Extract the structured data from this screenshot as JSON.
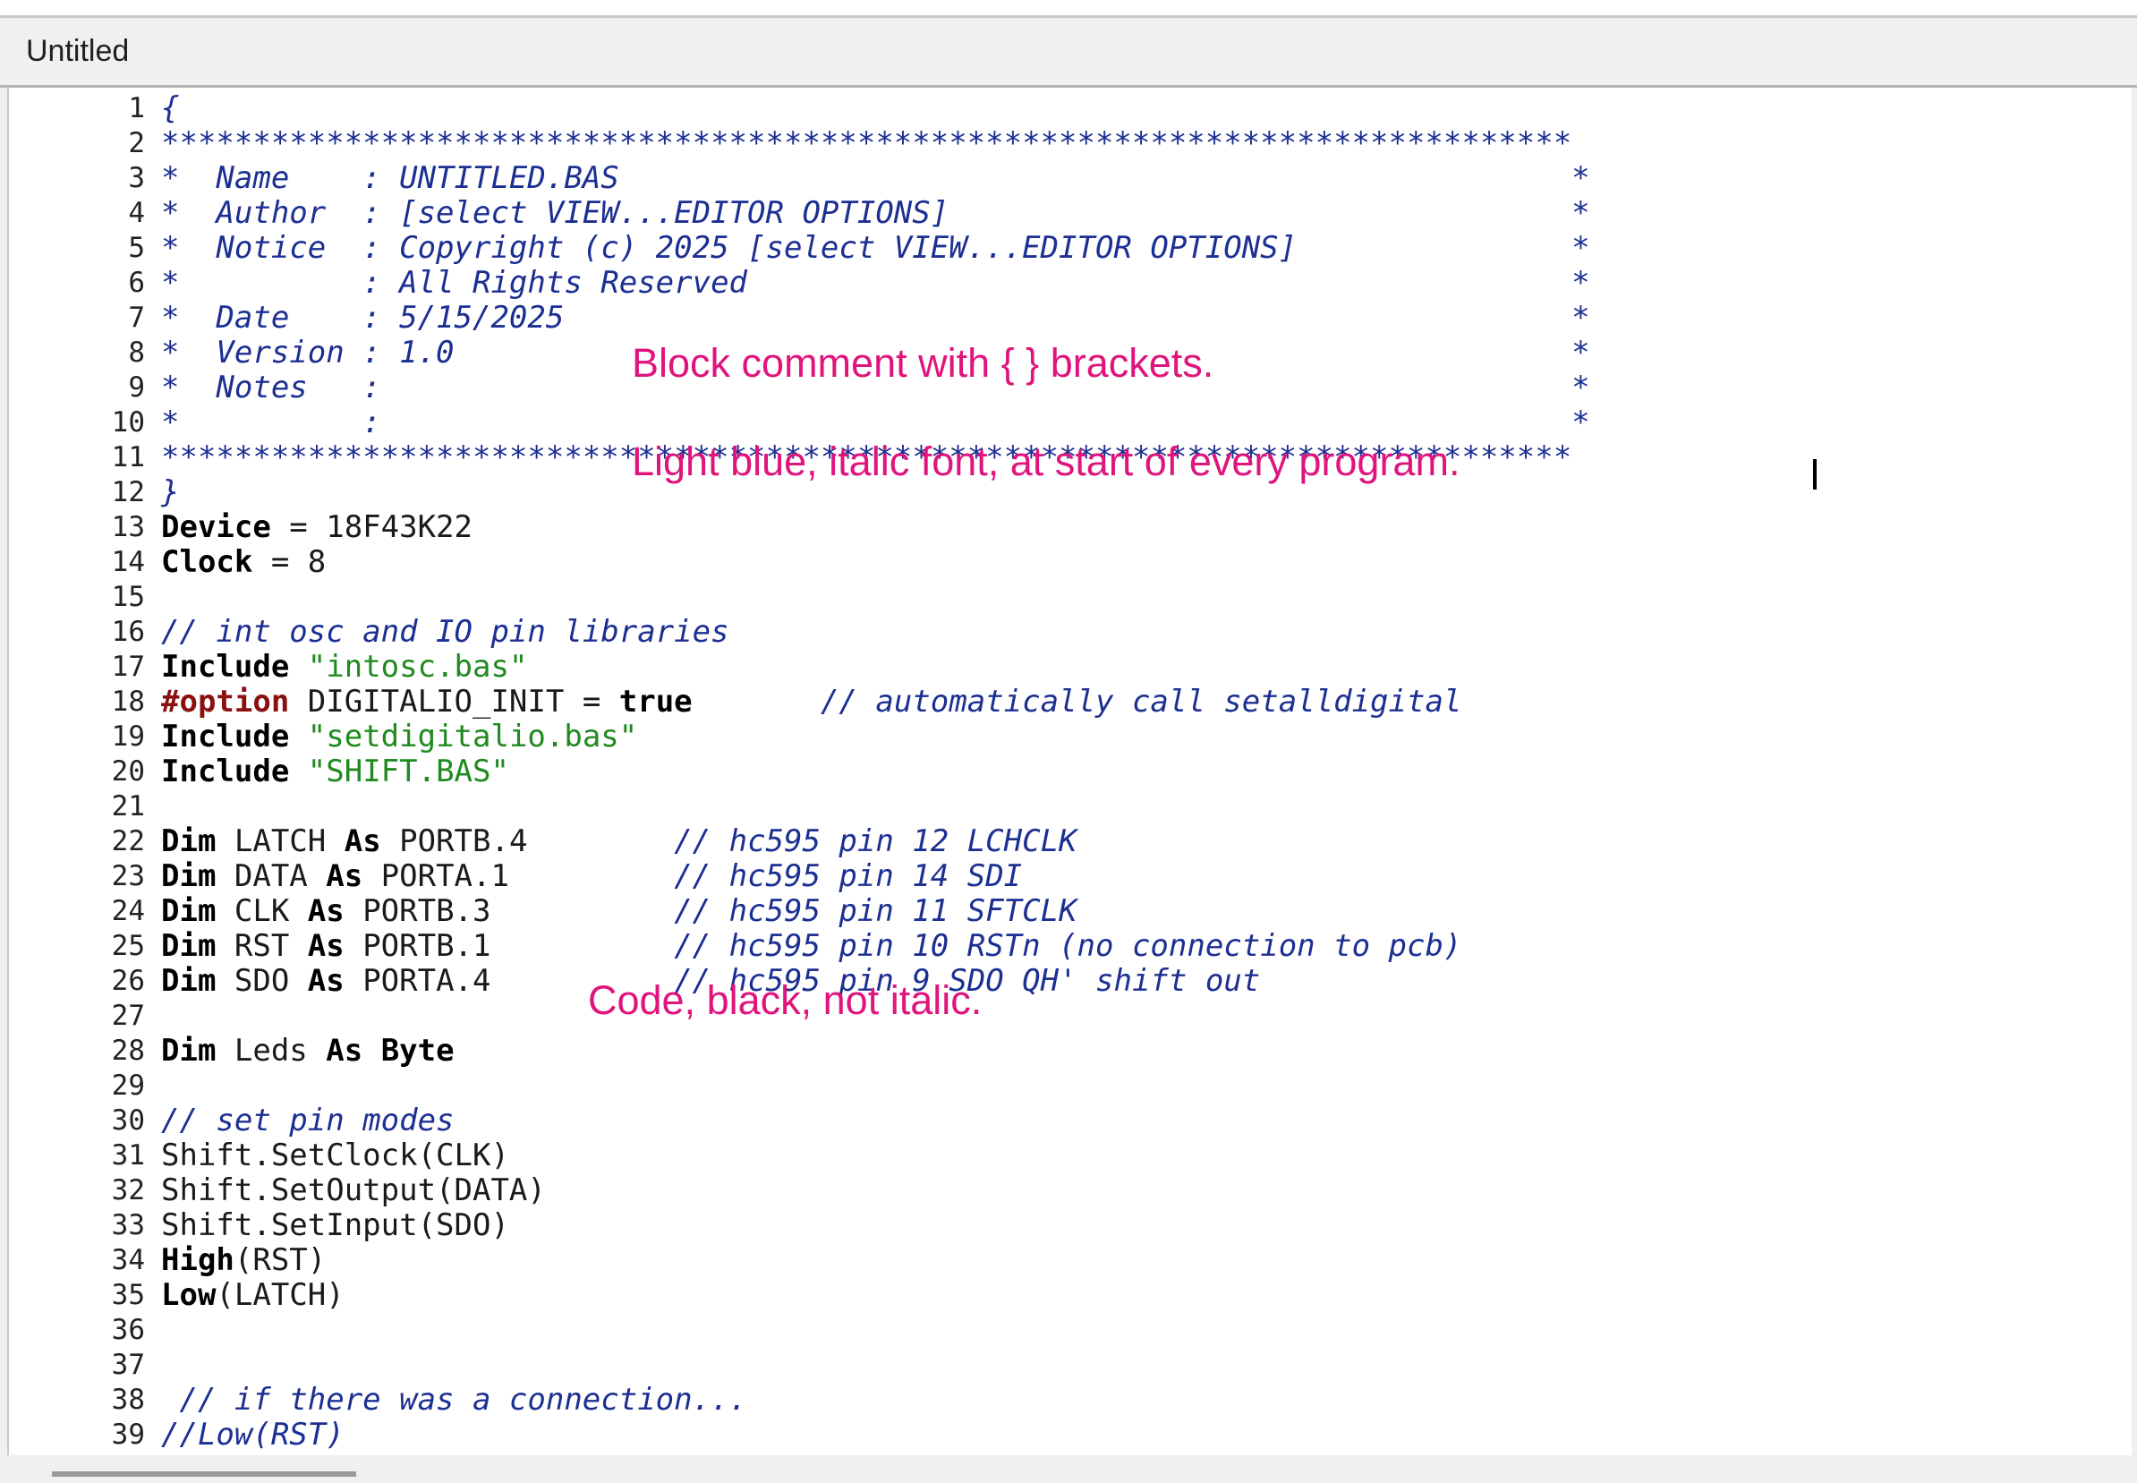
{
  "window": {
    "tab_title": "Untitled"
  },
  "editor": {
    "lines": [
      {
        "n": "1",
        "parts": [
          {
            "t": "{",
            "c": "cm"
          }
        ]
      },
      {
        "n": "2",
        "parts": [
          {
            "t": "*****************************************************************************",
            "c": "cm"
          }
        ]
      },
      {
        "n": "3",
        "parts": [
          {
            "t": "*  Name    : UNTITLED.BAS                                                    *",
            "c": "cm"
          }
        ]
      },
      {
        "n": "4",
        "parts": [
          {
            "t": "*  Author  : [select VIEW...EDITOR OPTIONS]                                  *",
            "c": "cm"
          }
        ]
      },
      {
        "n": "5",
        "parts": [
          {
            "t": "*  Notice  : Copyright (c) 2025 [select VIEW...EDITOR OPTIONS]               *",
            "c": "cm"
          }
        ]
      },
      {
        "n": "6",
        "parts": [
          {
            "t": "*          : All Rights Reserved                                             *",
            "c": "cm"
          }
        ]
      },
      {
        "n": "7",
        "parts": [
          {
            "t": "*  Date    : 5/15/2025                                                       *",
            "c": "cm"
          }
        ]
      },
      {
        "n": "8",
        "parts": [
          {
            "t": "*  Version : 1.0                                                             *",
            "c": "cm"
          }
        ]
      },
      {
        "n": "9",
        "parts": [
          {
            "t": "*  Notes   :                                                                 *",
            "c": "cm"
          }
        ]
      },
      {
        "n": "10",
        "parts": [
          {
            "t": "*          :                                                                 *",
            "c": "cm"
          }
        ]
      },
      {
        "n": "11",
        "parts": [
          {
            "t": "*****************************************************************************",
            "c": "cm"
          }
        ]
      },
      {
        "n": "12",
        "parts": [
          {
            "t": "}",
            "c": "cm"
          }
        ]
      },
      {
        "n": "13",
        "parts": [
          {
            "t": "Device",
            "c": "kw"
          },
          {
            "t": " = 18F43K22",
            "c": ""
          }
        ]
      },
      {
        "n": "14",
        "parts": [
          {
            "t": "Clock",
            "c": "kw"
          },
          {
            "t": " = 8",
            "c": ""
          }
        ]
      },
      {
        "n": "15",
        "parts": []
      },
      {
        "n": "16",
        "parts": [
          {
            "t": "// int osc and IO pin libraries",
            "c": "cm"
          }
        ]
      },
      {
        "n": "17",
        "parts": [
          {
            "t": "Include",
            "c": "kw"
          },
          {
            "t": " ",
            "c": ""
          },
          {
            "t": "\"intosc.bas\"",
            "c": "str"
          }
        ]
      },
      {
        "n": "18",
        "parts": [
          {
            "t": "#option",
            "c": "dir"
          },
          {
            "t": " DIGITALIO_INIT = ",
            "c": ""
          },
          {
            "t": "true",
            "c": "kw"
          },
          {
            "t": "       ",
            "c": ""
          },
          {
            "t": "// automatically call setalldigital",
            "c": "cm"
          }
        ]
      },
      {
        "n": "19",
        "parts": [
          {
            "t": "Include",
            "c": "kw"
          },
          {
            "t": " ",
            "c": ""
          },
          {
            "t": "\"setdigitalio.bas\"",
            "c": "str"
          }
        ]
      },
      {
        "n": "20",
        "parts": [
          {
            "t": "Include",
            "c": "kw"
          },
          {
            "t": " ",
            "c": ""
          },
          {
            "t": "\"SHIFT.BAS\"",
            "c": "str"
          }
        ]
      },
      {
        "n": "21",
        "parts": []
      },
      {
        "n": "22",
        "parts": [
          {
            "t": "Dim",
            "c": "kw"
          },
          {
            "t": " LATCH ",
            "c": ""
          },
          {
            "t": "As",
            "c": "kw"
          },
          {
            "t": " PORTB.4        ",
            "c": ""
          },
          {
            "t": "// hc595 pin 12 LCHCLK",
            "c": "cm"
          }
        ]
      },
      {
        "n": "23",
        "parts": [
          {
            "t": "Dim",
            "c": "kw"
          },
          {
            "t": " DATA ",
            "c": ""
          },
          {
            "t": "As",
            "c": "kw"
          },
          {
            "t": " PORTA.1         ",
            "c": ""
          },
          {
            "t": "// hc595 pin 14 SDI",
            "c": "cm"
          }
        ]
      },
      {
        "n": "24",
        "parts": [
          {
            "t": "Dim",
            "c": "kw"
          },
          {
            "t": " CLK ",
            "c": ""
          },
          {
            "t": "As",
            "c": "kw"
          },
          {
            "t": " PORTB.3          ",
            "c": ""
          },
          {
            "t": "// hc595 pin 11 SFTCLK",
            "c": "cm"
          }
        ]
      },
      {
        "n": "25",
        "parts": [
          {
            "t": "Dim",
            "c": "kw"
          },
          {
            "t": " RST ",
            "c": ""
          },
          {
            "t": "As",
            "c": "kw"
          },
          {
            "t": " PORTB.1          ",
            "c": ""
          },
          {
            "t": "// hc595 pin 10 RSTn (no connection to pcb)",
            "c": "cm"
          }
        ]
      },
      {
        "n": "26",
        "parts": [
          {
            "t": "Dim",
            "c": "kw"
          },
          {
            "t": " SDO ",
            "c": ""
          },
          {
            "t": "As",
            "c": "kw"
          },
          {
            "t": " PORTA.4          ",
            "c": ""
          },
          {
            "t": "// hc595 pin 9 SDO QH' shift out",
            "c": "cm"
          }
        ]
      },
      {
        "n": "27",
        "parts": []
      },
      {
        "n": "28",
        "parts": [
          {
            "t": "Dim",
            "c": "kw"
          },
          {
            "t": " Leds ",
            "c": ""
          },
          {
            "t": "As",
            "c": "kw"
          },
          {
            "t": " ",
            "c": ""
          },
          {
            "t": "Byte",
            "c": "kw"
          }
        ]
      },
      {
        "n": "29",
        "parts": []
      },
      {
        "n": "30",
        "parts": [
          {
            "t": "// set pin modes",
            "c": "cm"
          }
        ]
      },
      {
        "n": "31",
        "parts": [
          {
            "t": "Shift.SetClock(CLK)",
            "c": ""
          }
        ]
      },
      {
        "n": "32",
        "parts": [
          {
            "t": "Shift.SetOutput(DATA)",
            "c": ""
          }
        ]
      },
      {
        "n": "33",
        "parts": [
          {
            "t": "Shift.SetInput(SDO)",
            "c": ""
          }
        ]
      },
      {
        "n": "34",
        "parts": [
          {
            "t": "High",
            "c": "kw"
          },
          {
            "t": "(RST)",
            "c": ""
          }
        ]
      },
      {
        "n": "35",
        "parts": [
          {
            "t": "Low",
            "c": "kw"
          },
          {
            "t": "(LATCH)",
            "c": ""
          }
        ]
      },
      {
        "n": "36",
        "parts": []
      },
      {
        "n": "37",
        "parts": []
      },
      {
        "n": "38",
        "parts": [
          {
            "t": " // if there was a connection...",
            "c": "cm"
          }
        ]
      },
      {
        "n": "39",
        "parts": [
          {
            "t": "//Low(RST)",
            "c": "cm"
          }
        ]
      }
    ]
  },
  "annotations": {
    "block_comment": "Block comment with { } brackets.",
    "light_blue": "Light blue, italic font, at start of every program.",
    "code_black": "Code, black, not italic."
  },
  "colors": {
    "annotation": "#e0147c",
    "comment": "#1c2f92",
    "string": "#1f8a1f",
    "directive": "#8a1010"
  }
}
